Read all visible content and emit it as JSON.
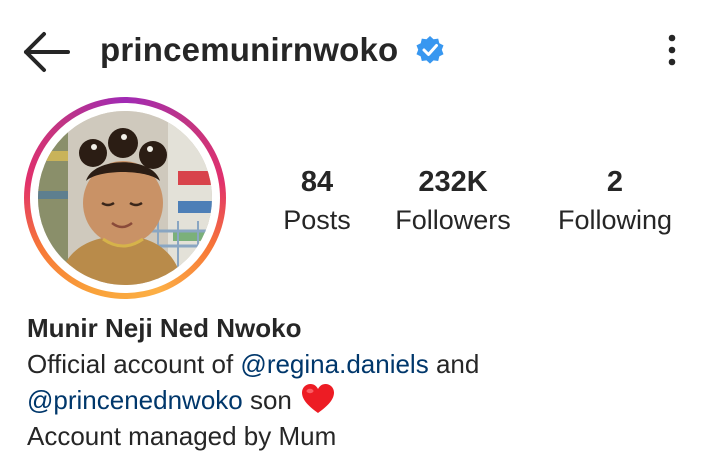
{
  "header": {
    "username": "princemunirnwoko",
    "verified": true,
    "icons": {
      "back": "arrow-left-icon",
      "verified": "verified-badge-icon",
      "menu": "more-vertical-icon"
    }
  },
  "stats": {
    "posts": {
      "value": "84",
      "label": "Posts"
    },
    "followers": {
      "value": "232K",
      "label": "Followers"
    },
    "following": {
      "value": "2",
      "label": "Following"
    }
  },
  "bio": {
    "name": "Munir Neji Ned Nwoko",
    "line1_text": "Official account of ",
    "line1_mention": "@regina.daniels",
    "line1_suffix": " and",
    "line2_mention": "@princenednwoko",
    "line2_suffix": " son",
    "line2_emoji": "heart-icon",
    "line3_text": "Account managed by Mum"
  },
  "colors": {
    "text": "#262626",
    "mention": "#00376b",
    "verified": "#3897f0",
    "heart": "#ed1c24"
  }
}
